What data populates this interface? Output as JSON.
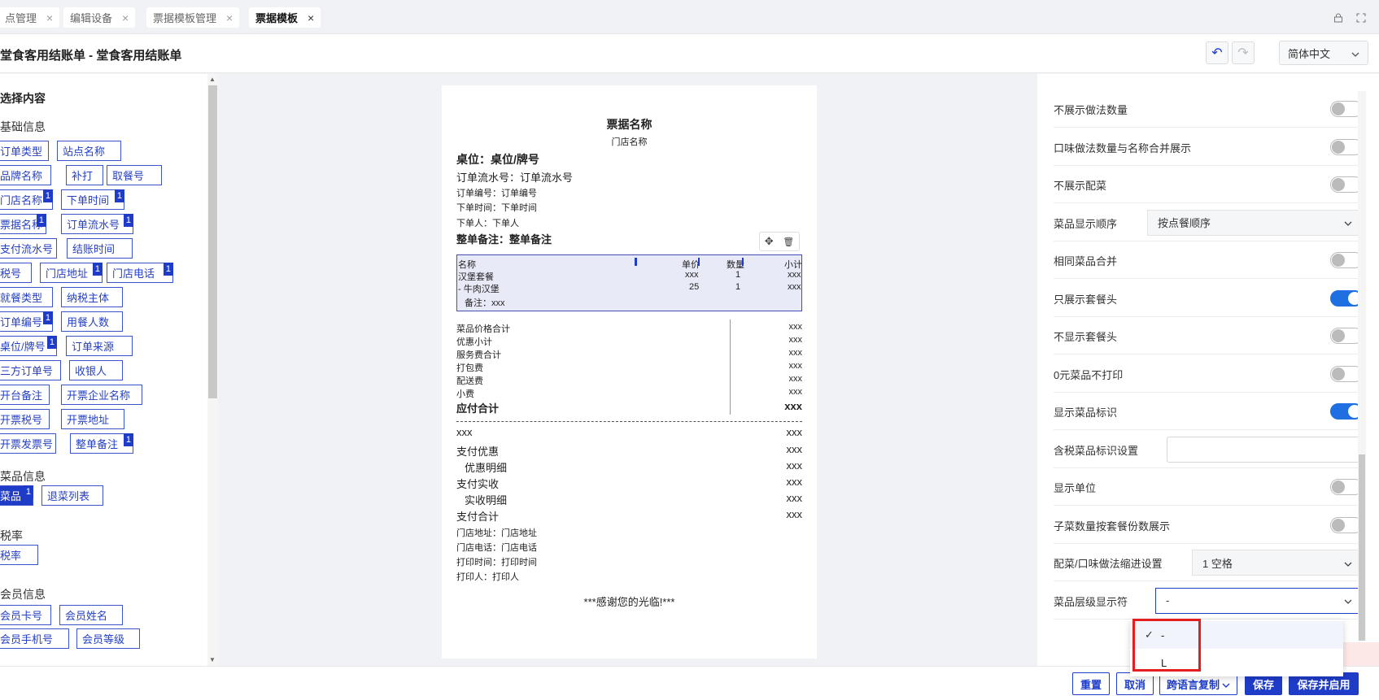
{
  "tabs": [
    {
      "label": "点管理",
      "close": "×"
    },
    {
      "label": "编辑设备",
      "close": "×"
    },
    {
      "label": "票据模板管理",
      "close": "×"
    },
    {
      "label": "票据模板",
      "close": "×"
    }
  ],
  "topbar_icons": {
    "left": "lock-icon",
    "right": "fullscreen-icon"
  },
  "header": {
    "title": "堂食客用结账单 - 堂食客用结账单",
    "undo_glyph": "↶",
    "redo_glyph": "↷",
    "language": "简体中文",
    "caret": "⌄"
  },
  "left": {
    "title": "选择内容",
    "sections": {
      "basic": {
        "title": "基础信息",
        "chips": [
          {
            "label": "订单类型"
          },
          {
            "label": "站点名称"
          },
          {
            "label": "品牌名称"
          },
          {
            "label": "补打"
          },
          {
            "label": "取餐号"
          },
          {
            "label": "门店名称",
            "badge": "1"
          },
          {
            "label": "下单时间",
            "badge": "1"
          },
          {
            "label": "票据名称",
            "badge": "1"
          },
          {
            "label": "订单流水号",
            "badge": "1"
          },
          {
            "label": "支付流水号"
          },
          {
            "label": "结账时间"
          },
          {
            "label": "税号"
          },
          {
            "label": "门店地址",
            "badge": "1"
          },
          {
            "label": "门店电话",
            "badge": "1"
          },
          {
            "label": "就餐类型"
          },
          {
            "label": "纳税主体"
          },
          {
            "label": "订单编号",
            "badge": "1"
          },
          {
            "label": "用餐人数"
          },
          {
            "label": "桌位/牌号",
            "badge": "1"
          },
          {
            "label": "订单来源"
          },
          {
            "label": "三方订单号"
          },
          {
            "label": "收银人"
          },
          {
            "label": "开台备注"
          },
          {
            "label": "开票企业名称"
          },
          {
            "label": "开票税号"
          },
          {
            "label": "开票地址"
          },
          {
            "label": "开票发票号"
          },
          {
            "label": "整单备注",
            "badge": "1"
          }
        ]
      },
      "dish": {
        "title": "菜品信息",
        "chips": [
          {
            "label": "菜品",
            "badge": "1"
          },
          {
            "label": "退菜列表"
          }
        ]
      },
      "tax": {
        "title": "税率",
        "chips": [
          {
            "label": "税率"
          }
        ]
      },
      "member": {
        "title": "会员信息",
        "chips": [
          {
            "label": "会员卡号"
          },
          {
            "label": "会员姓名"
          },
          {
            "label": "会员手机号"
          },
          {
            "label": "会员等级"
          }
        ]
      }
    }
  },
  "receipt": {
    "name": "票据名称",
    "store": "门店名称",
    "table": "桌位：桌位/牌号",
    "serial": "订单流水号：订单流水号",
    "order_no": "订单编号：订单编号",
    "order_time": "下单时间：下单时间",
    "orderer": "下单人：下单人",
    "remark": "整单备注：整单备注",
    "tool_icons": {
      "move": "✥",
      "delete": "🗑"
    },
    "items": {
      "headers": [
        "名称",
        "单价",
        "数量",
        "小计"
      ],
      "rows": [
        [
          "汉堡套餐",
          "xxx",
          "1",
          "xxx"
        ],
        [
          "- 牛肉汉堡",
          "25",
          "1",
          "xxx"
        ]
      ],
      "note": "备注：xxx"
    },
    "totals": [
      [
        "菜品价格合计",
        "xxx"
      ],
      [
        "优惠小计",
        "xxx"
      ],
      [
        "服务费合计",
        "xxx"
      ],
      [
        "打包费",
        "xxx"
      ],
      [
        "配送费",
        "xxx"
      ],
      [
        "小费",
        "xxx"
      ]
    ],
    "payable": [
      "应付合计",
      "xxx"
    ],
    "payments": [
      [
        "xxx",
        "xxx"
      ],
      [
        "支付优惠",
        "xxx"
      ],
      [
        "优惠明细",
        "xxx"
      ],
      [
        "支付实收",
        "xxx"
      ],
      [
        "实收明细",
        "xxx"
      ],
      [
        "支付合计",
        "xxx"
      ]
    ],
    "footer_lines": [
      "门店地址：门店地址",
      "门店电话：门店电话",
      "打印时间：打印时间",
      "打印人：打印人"
    ],
    "thanks": "***感谢您的光临!***"
  },
  "settings": [
    {
      "label": "不展示做法数量",
      "type": "toggle",
      "on": false
    },
    {
      "label": "口味做法数量与名称合并展示",
      "type": "toggle",
      "on": false
    },
    {
      "label": "不展示配菜",
      "type": "toggle",
      "on": false
    },
    {
      "label": "菜品显示顺序",
      "type": "select",
      "value": "按点餐顺序"
    },
    {
      "label": "相同菜品合并",
      "type": "toggle",
      "on": false
    },
    {
      "label": "只展示套餐头",
      "type": "toggle",
      "on": true
    },
    {
      "label": "不显示套餐头",
      "type": "toggle",
      "on": false
    },
    {
      "label": "0元菜品不打印",
      "type": "toggle",
      "on": false
    },
    {
      "label": "显示菜品标识",
      "type": "toggle",
      "on": true
    },
    {
      "label": "含税菜品标识设置",
      "type": "input",
      "value": ""
    },
    {
      "label": "显示单位",
      "type": "toggle",
      "on": false
    },
    {
      "label": "子菜数量按套餐份数展示",
      "type": "toggle",
      "on": false
    },
    {
      "label": "配菜/口味做法缩进设置",
      "type": "select",
      "value": "1 空格"
    },
    {
      "label": "菜品层级显示符",
      "type": "select",
      "value": "-",
      "focused": true
    }
  ],
  "dropdown": {
    "options": [
      "-",
      "L"
    ],
    "selected": 0,
    "check": "✓"
  },
  "footer": {
    "reset": "重置",
    "cancel": "取消",
    "copy": "跨语言复制",
    "save": "保存",
    "save_enable": "保存并启用"
  }
}
